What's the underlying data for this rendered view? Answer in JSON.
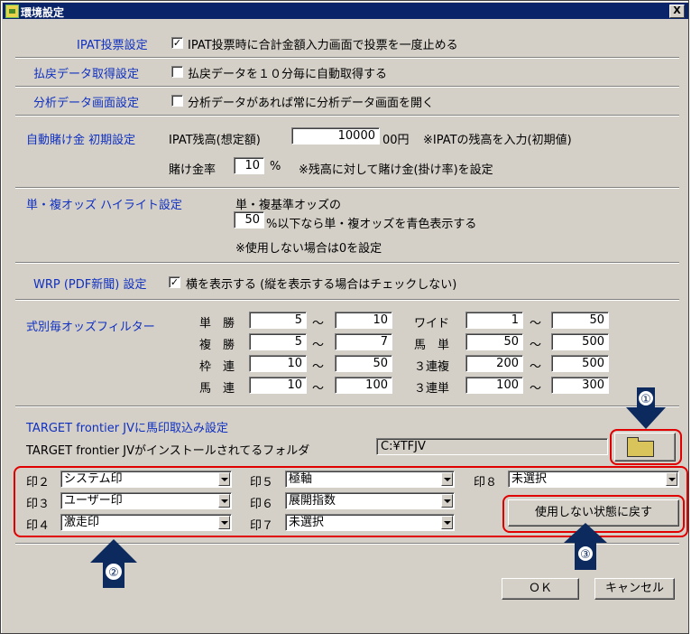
{
  "title": "環境設定",
  "close": "X",
  "ipat": {
    "section": "IPAT投票設定",
    "check": "✓",
    "label": "IPAT投票時に合計金額入力画面で投票を一度止める"
  },
  "haraimodoshi": {
    "section": "払戻データ取得設定",
    "label": "払戻データを１０分毎に自動取得する"
  },
  "bunseki": {
    "section": "分析データ画面設定",
    "label": "分析データがあれば常に分析データ画面を開く"
  },
  "auto": {
    "section": "自動賭け金 初期設定",
    "zan_label": "IPAT残高(想定額)",
    "zan_value": "10000",
    "zan_unit": "00円",
    "zan_note": "※IPATの残高を入力(初期値)",
    "rate_label": "賭け金率",
    "rate_value": "10",
    "rate_unit": "%",
    "rate_note": "※残高に対して賭け金(掛け率)を設定"
  },
  "highlight": {
    "section": "単・複オッズ ハイライト設定",
    "line1": "単・複基準オッズの",
    "value": "50",
    "line2": "%以下なら単・複オッズを青色表示する",
    "note": "※使用しない場合は0を設定"
  },
  "wrp": {
    "section": "WRP (PDF新聞) 設定",
    "check": "✓",
    "label": "横を表示する (縦を表示する場合はチェックしない)"
  },
  "filter": {
    "section": "式別毎オッズフィルター",
    "tilde": "～",
    "left": [
      {
        "label": "単　勝",
        "min": "5",
        "max": "10"
      },
      {
        "label": "複　勝",
        "min": "5",
        "max": "7"
      },
      {
        "label": "枠　連",
        "min": "10",
        "max": "50"
      },
      {
        "label": "馬　連",
        "min": "10",
        "max": "100"
      }
    ],
    "right": [
      {
        "label": "ワイド",
        "min": "1",
        "max": "50"
      },
      {
        "label": "馬　単",
        "min": "50",
        "max": "500"
      },
      {
        "label": "３連複",
        "min": "200",
        "max": "500"
      },
      {
        "label": "３連単",
        "min": "100",
        "max": "300"
      }
    ]
  },
  "target": {
    "section": "TARGET frontier JVに馬印取込み設定",
    "folder_label": "TARGET frontier JVがインストールされてるフォルダ",
    "folder_value": "C:¥TFJV"
  },
  "marks": [
    {
      "label": "印２",
      "value": "システム印"
    },
    {
      "label": "印３",
      "value": "ユーザー印"
    },
    {
      "label": "印４",
      "value": "激走印"
    },
    {
      "label": "印５",
      "value": "極軸"
    },
    {
      "label": "印６",
      "value": "展開指数"
    },
    {
      "label": "印７",
      "value": "未選択"
    },
    {
      "label": "印８",
      "value": "未選択"
    }
  ],
  "reset_label": "使用しない状態に戻す",
  "ok_label": "ＯＫ",
  "cancel_label": "キャンセル",
  "annotations": {
    "a1": "①",
    "a2": "②",
    "a3": "③",
    "arrow_color": "#0d2a5e",
    "highlight_color": "#e00000"
  }
}
